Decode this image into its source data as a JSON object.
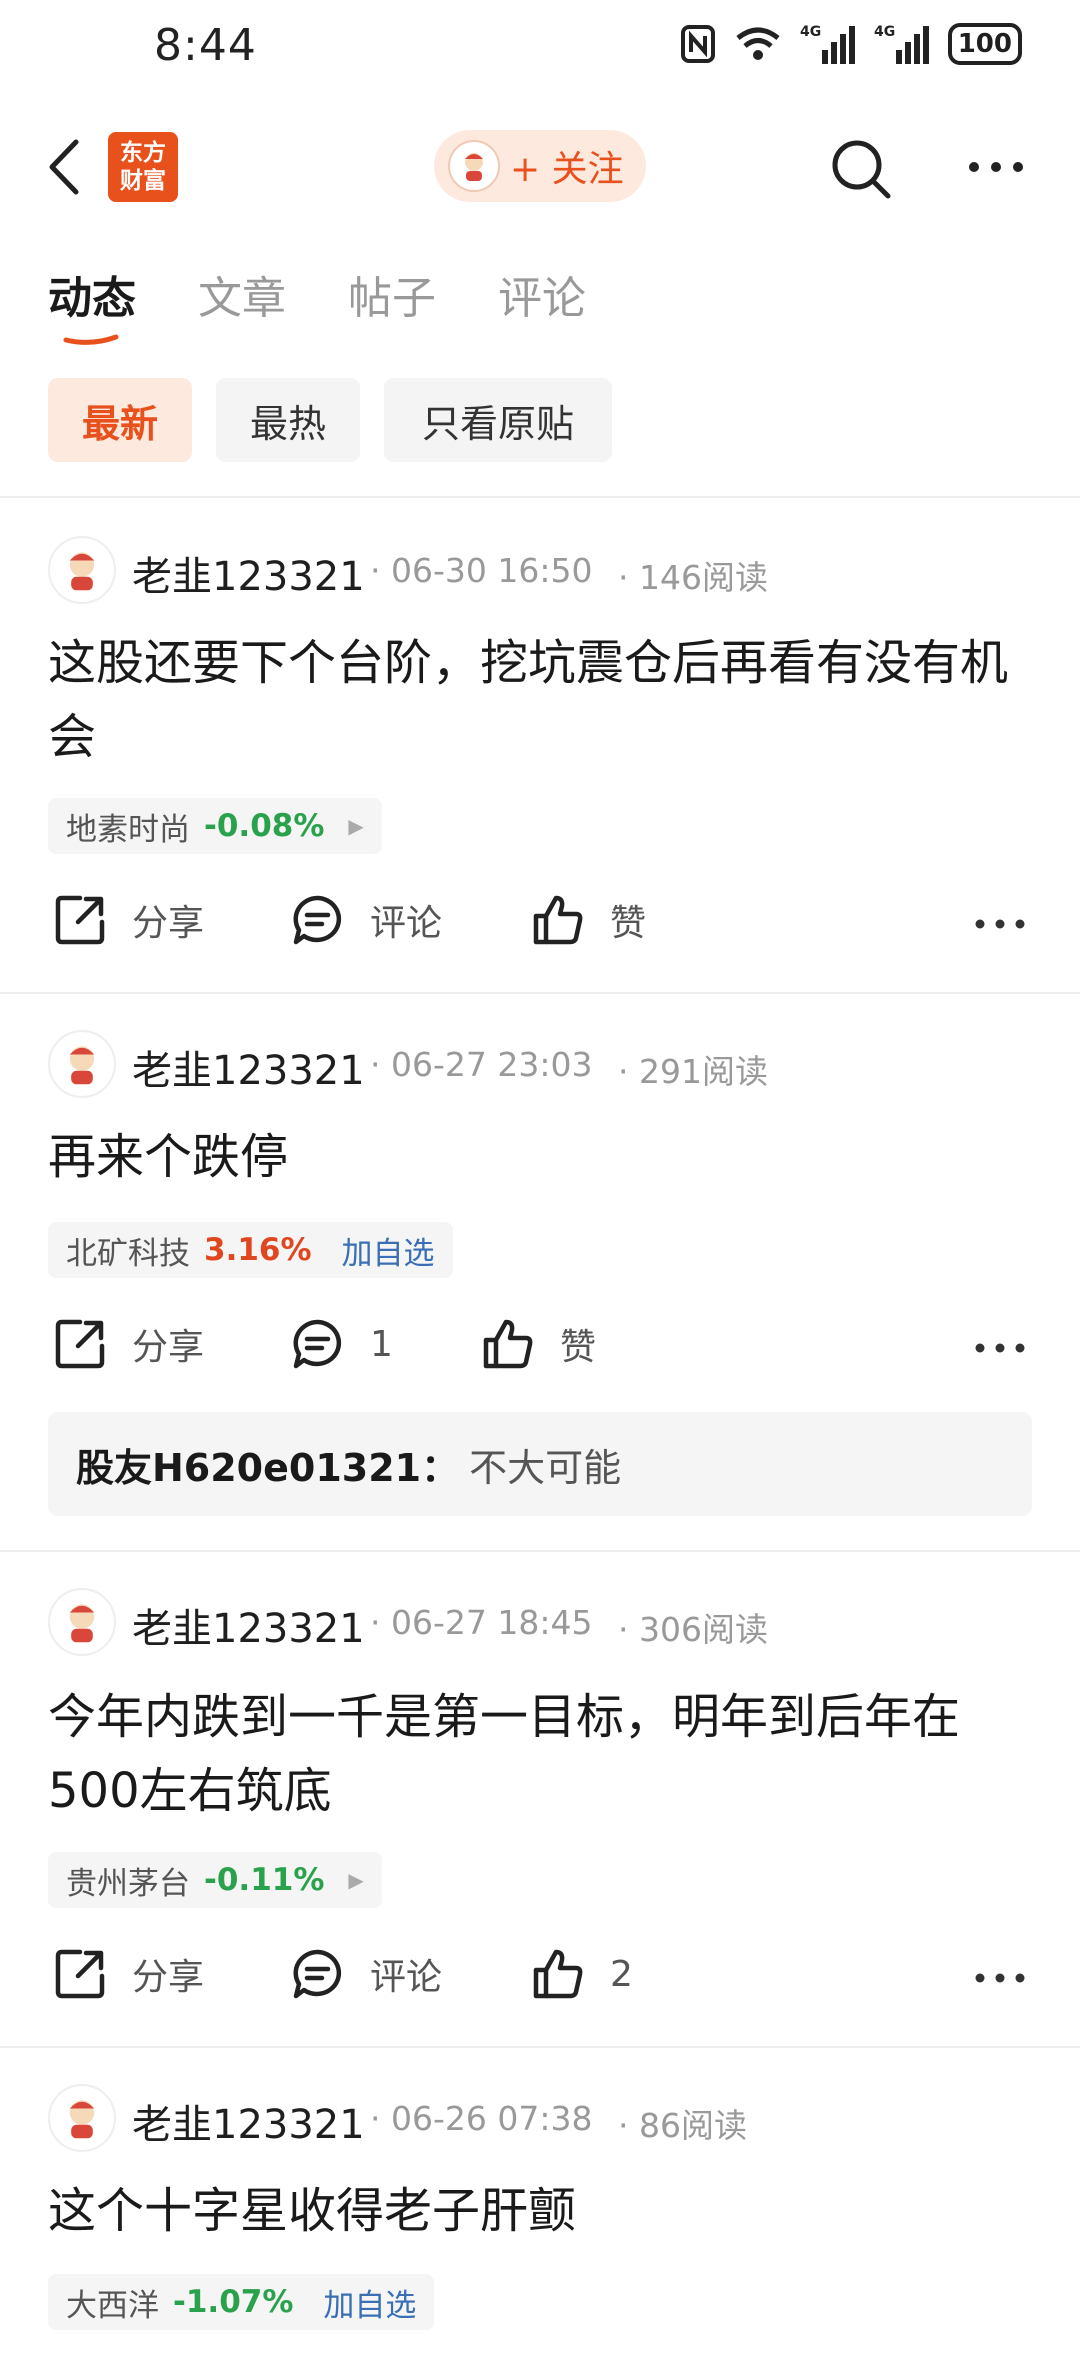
{
  "status_bar": {
    "time": "8:44",
    "network": "4G",
    "battery": "100"
  },
  "nav": {
    "brand_line1": "东方",
    "brand_line2": "财富",
    "follow_label": "+ 关注"
  },
  "tabs": [
    {
      "label": "动态",
      "active": true
    },
    {
      "label": "文章",
      "active": false
    },
    {
      "label": "帖子",
      "active": false
    },
    {
      "label": "评论",
      "active": false
    }
  ],
  "filters": [
    {
      "label": "最新",
      "active": true
    },
    {
      "label": "最热",
      "active": false
    },
    {
      "label": "只看原贴",
      "active": false
    }
  ],
  "posts": [
    {
      "author": "老韭123321",
      "time": "· 06-30 16:50",
      "reads": "· 146阅读",
      "text": "这股还要下个台阶，挖坑震仓后再看有没有机会",
      "stock": {
        "name": "地素时尚",
        "change": "-0.08%"
      },
      "actions": {
        "share": "分享",
        "comment": "评论",
        "like": "赞"
      }
    },
    {
      "author": "老韭123321",
      "time": "· 06-27 23:03",
      "reads": "· 291阅读",
      "text": "再来个跌停",
      "stock": {
        "name": "北矿科技",
        "change": "3.16%",
        "add": "加自选"
      },
      "actions": {
        "share": "分享",
        "comment": "1",
        "like": "赞"
      },
      "reply": {
        "user": "股友H620e01321：",
        "text": "不大可能"
      }
    },
    {
      "author": "老韭123321",
      "time": "· 06-27 18:45",
      "reads": "· 306阅读",
      "text": "今年内跌到一千是第一目标，明年到后年在500左右筑底",
      "stock": {
        "name": "贵州茅台",
        "change": "-0.11%"
      },
      "actions": {
        "share": "分享",
        "comment": "评论",
        "like": "2"
      }
    },
    {
      "author": "老韭123321",
      "time": "· 06-26 07:38",
      "reads": "· 86阅读",
      "text": "这个十字星收得老子肝颤",
      "stock": {
        "name": "大西洋",
        "change": "-1.07%",
        "add": "加自选"
      }
    }
  ],
  "colors": {
    "accent": "#e8501c",
    "up": "#e0471e",
    "down": "#2aa14c",
    "link": "#3a6fb5"
  },
  "icons": [
    "back-arrow-icon",
    "search-icon",
    "more-icon",
    "share-icon",
    "comment-icon",
    "like-icon",
    "more-dots-icon",
    "arrow-right-icon",
    "avatar-icon"
  ]
}
